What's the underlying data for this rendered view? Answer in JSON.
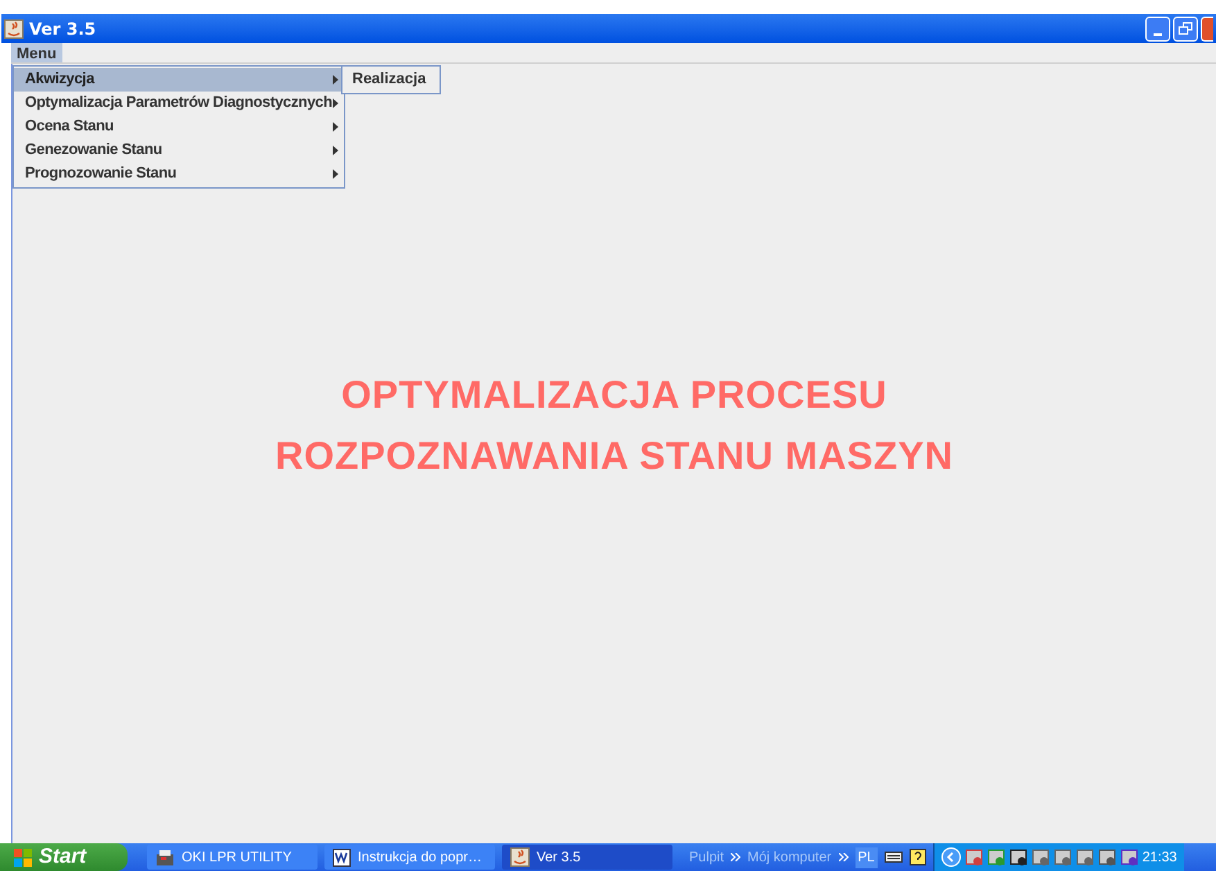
{
  "window": {
    "title": "Ver 3.5"
  },
  "menubar": [
    {
      "label": "Menu",
      "selected": true
    }
  ],
  "menu": [
    {
      "label": "Akwizycja",
      "selected": true,
      "submenu": true
    },
    {
      "label": "Optymalizacja Parametrów Diagnostycznych",
      "selected": false,
      "submenu": true
    },
    {
      "label": "Ocena Stanu",
      "selected": false,
      "submenu": true
    },
    {
      "label": "Genezowanie Stanu",
      "selected": false,
      "submenu": true
    },
    {
      "label": "Prognozowanie Stanu",
      "selected": false,
      "submenu": true
    }
  ],
  "submenu": [
    {
      "label": "Realizacja"
    }
  ],
  "headline": [
    "OPTYMALIZACJA PROCESU",
    "ROZPOZNAWANIA STANU MASZYN"
  ],
  "taskbar": {
    "start": "Start",
    "tasks": [
      {
        "label": "OKI LPR UTILITY",
        "kind": "printer",
        "selected": false
      },
      {
        "label": "Instrukcja do popr…",
        "kind": "document",
        "selected": false
      },
      {
        "label": "Ver 3.5",
        "kind": "java",
        "selected": true
      }
    ],
    "toolbars": [
      "Pulpit",
      "Mój komputer"
    ],
    "language": "PL",
    "clock": "21:33"
  }
}
